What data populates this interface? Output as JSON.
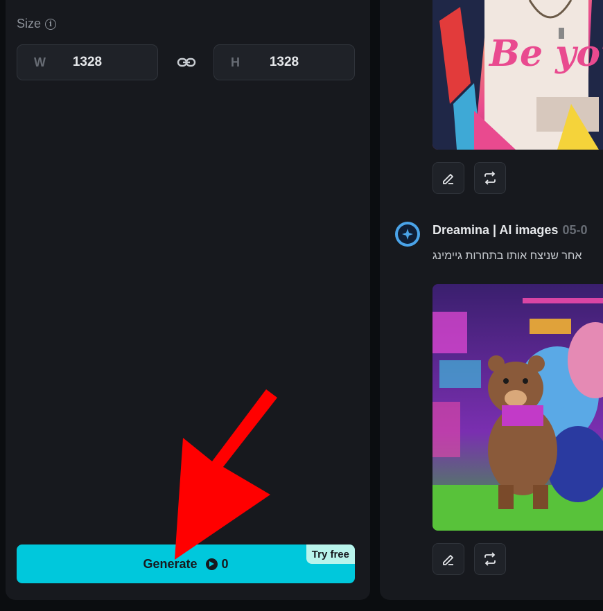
{
  "size": {
    "label": "Size",
    "width_letter": "W",
    "width_value": "1328",
    "height_letter": "H",
    "height_value": "1328"
  },
  "generate": {
    "label": "Generate",
    "credits": "0",
    "badge": "Try free"
  },
  "feed": {
    "sender": "Dreamina | AI images",
    "date": "05-0",
    "message": "אחר שניצח אותו בתחרות גיימינג",
    "image1_text": "Be yours"
  },
  "colors": {
    "accent": "#00c8dc",
    "panel": "#17191e",
    "annotation_arrow": "#ff0000"
  },
  "icons": [
    "info-icon",
    "link-icon",
    "edit-icon",
    "regenerate-icon",
    "credit-icon",
    "dreamina-logo-icon"
  ]
}
